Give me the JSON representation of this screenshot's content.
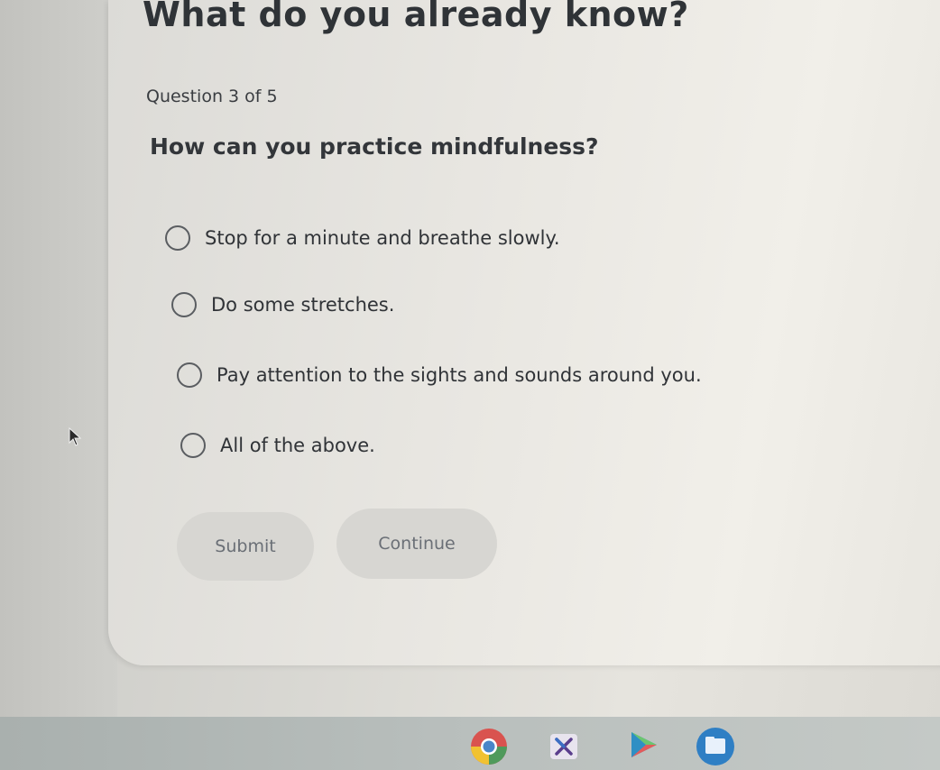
{
  "page": {
    "title": "What do you already know?",
    "counter": "Question 3 of 5",
    "question": "How can you practice mindfulness?"
  },
  "options": [
    {
      "label": "Stop for a minute and breathe slowly.",
      "selected": false
    },
    {
      "label": "Do some stretches.",
      "selected": false
    },
    {
      "label": "Pay attention to the sights and sounds around you.",
      "selected": false
    },
    {
      "label": "All of the above.",
      "selected": false
    }
  ],
  "buttons": {
    "submit": "Submit",
    "continue": "Continue"
  },
  "taskbar": {
    "icons": [
      "chrome-icon",
      "docs-icon",
      "play-store-icon",
      "files-icon"
    ]
  },
  "colors": {
    "text": "#303337",
    "button_bg": "#d7d6d2",
    "button_text": "#6a6f76"
  }
}
